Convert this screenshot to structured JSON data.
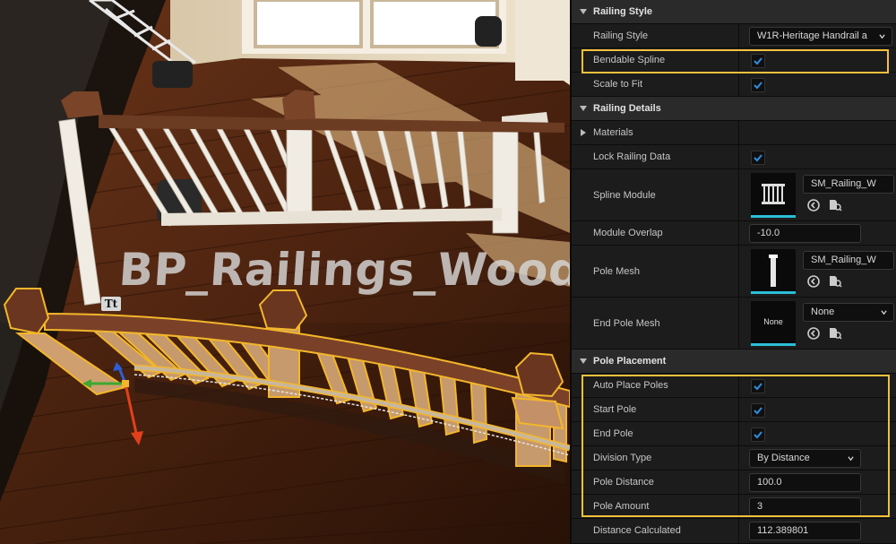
{
  "viewport": {
    "watermark": "BP_Railings_Wood",
    "text_tool_badge": "Tt"
  },
  "panel": {
    "sections": {
      "railing_style": "Railing Style",
      "railing_details": "Railing Details",
      "pole_placement": "Pole Placement"
    },
    "rows": {
      "railing_style": {
        "label": "Railing Style",
        "value": "W1R-Heritage Handrail a"
      },
      "bendable_spline": {
        "label": "Bendable Spline",
        "checked": true
      },
      "scale_to_fit": {
        "label": "Scale to Fit",
        "checked": true
      },
      "materials": {
        "label": "Materials"
      },
      "lock_railing_data": {
        "label": "Lock Railing Data",
        "checked": true
      },
      "spline_module": {
        "label": "Spline Module",
        "value": "SM_Railing_W"
      },
      "module_overlap": {
        "label": "Module Overlap",
        "value": "-10.0"
      },
      "pole_mesh": {
        "label": "Pole Mesh",
        "value": "SM_Railing_W"
      },
      "end_pole_mesh": {
        "label": "End Pole Mesh",
        "value": "None",
        "thumb_text": "None"
      },
      "auto_place_poles": {
        "label": "Auto Place Poles",
        "checked": true
      },
      "start_pole": {
        "label": "Start Pole",
        "checked": true
      },
      "end_pole": {
        "label": "End Pole",
        "checked": true
      },
      "division_type": {
        "label": "Division Type",
        "value": "By Distance"
      },
      "pole_distance": {
        "label": "Pole Distance",
        "value": "100.0"
      },
      "pole_amount": {
        "label": "Pole Amount",
        "value": "3"
      },
      "distance_calculated": {
        "label": "Distance Calculated",
        "value": "112.389801"
      }
    }
  },
  "colors": {
    "highlight": "#f3c13a",
    "checkbox_accent": "#2c8fe0",
    "thumb_accent": "#2bbfd6",
    "panel_bg": "#1c1c1c",
    "category_bg": "#2a2a2a"
  }
}
